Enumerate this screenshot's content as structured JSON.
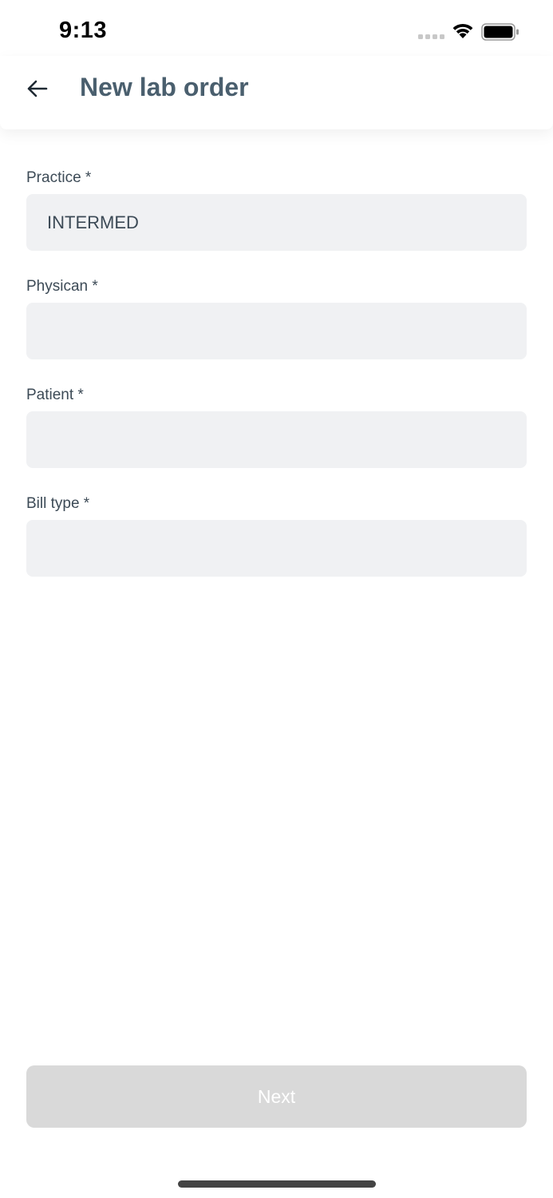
{
  "status_bar": {
    "time": "9:13",
    "icons": [
      "signal-icon",
      "wifi-icon",
      "battery-icon"
    ]
  },
  "header": {
    "title": "New lab order",
    "back_icon": "arrow-left-icon"
  },
  "form": {
    "fields": [
      {
        "label": "Practice *",
        "value": "INTERMED"
      },
      {
        "label": "Physican *",
        "value": ""
      },
      {
        "label": "Patient *",
        "value": ""
      },
      {
        "label": "Bill type *",
        "value": ""
      }
    ]
  },
  "actions": {
    "next_label": "Next",
    "next_disabled": true
  },
  "colors": {
    "title": "#4a5f6e",
    "label": "#3c4a56",
    "input_bg": "#f0f1f3",
    "button_disabled_bg": "#d9d9d9"
  }
}
